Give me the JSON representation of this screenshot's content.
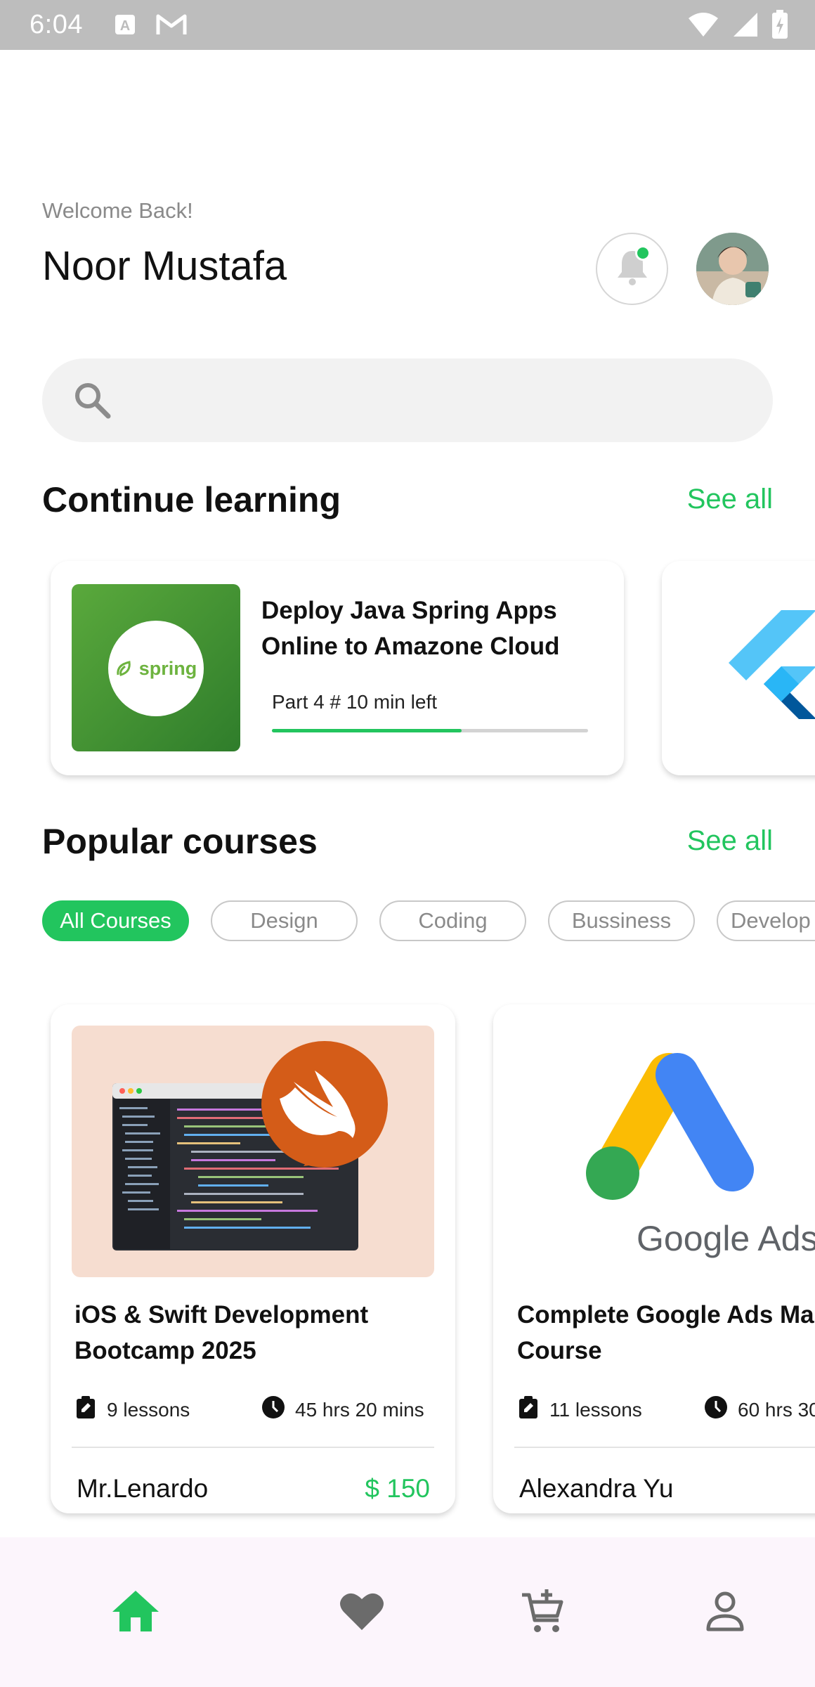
{
  "status_bar": {
    "time": "6:04"
  },
  "header": {
    "welcome": "Welcome Back!",
    "name": "Noor Mustafa"
  },
  "search": {
    "placeholder": ""
  },
  "continue_learning": {
    "title": "Continue learning",
    "see_all": "See all",
    "cards": [
      {
        "logo_text": "spring",
        "title": "Deploy Java Spring Apps Online to Amazone Cloud",
        "progress_label": "Part 4 # 10 min left",
        "progress": 0.6
      }
    ]
  },
  "popular_courses": {
    "title": "Popular courses",
    "see_all": "See all",
    "categories": [
      "All Courses",
      "Design",
      "Coding",
      "Bussiness",
      "Develop"
    ],
    "selected_category": "All Courses",
    "courses": [
      {
        "title": "iOS & Swift Development Bootcamp 2025",
        "lessons": "9 lessons",
        "duration": "45 hrs 20 mins",
        "author": "Mr.Lenardo",
        "price": "$ 150"
      },
      {
        "title": "Complete Google Ads Mastery Course",
        "lessons": "11 lessons",
        "duration": "60 hrs 30",
        "author": "Alexandra Yu",
        "price": "",
        "logo_text": "Google Ads"
      }
    ]
  },
  "bottom_nav": {
    "items": [
      "home-icon",
      "heart-icon",
      "cart-icon",
      "profile-icon"
    ],
    "active": "home-icon",
    "active_color": "#22c55e",
    "inactive_color": "#6b6b6b"
  },
  "colors": {
    "accent": "#22c55e"
  }
}
